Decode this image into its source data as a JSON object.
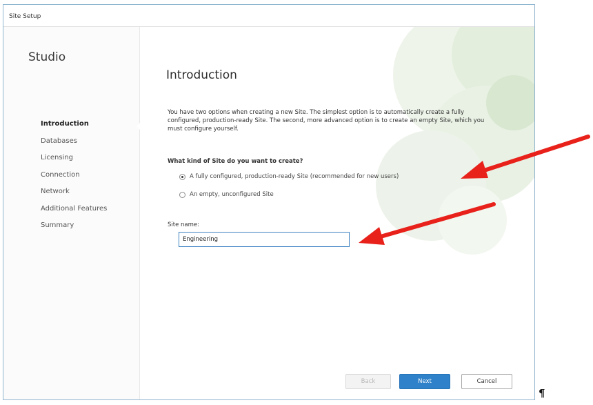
{
  "window": {
    "title": "Site Setup"
  },
  "sidebar": {
    "title": "Studio",
    "steps": [
      {
        "label": "Introduction",
        "active": true
      },
      {
        "label": "Databases"
      },
      {
        "label": "Licensing"
      },
      {
        "label": "Connection"
      },
      {
        "label": "Network"
      },
      {
        "label": "Additional Features"
      },
      {
        "label": "Summary"
      }
    ]
  },
  "main": {
    "title": "Introduction",
    "intro_text": "You have two options when creating a new Site. The simplest option is to automatically create a fully configured, production-ready Site. The second, more advanced option is to create an empty Site, which you must configure yourself.",
    "question": "What kind of Site do you want to create?",
    "options": [
      {
        "label": "A fully configured, production-ready Site (recommended for new users)",
        "selected": true
      },
      {
        "label": "An empty, unconfigured Site",
        "selected": false
      }
    ],
    "site_name_label": "Site name:",
    "site_name_value": "Engineering"
  },
  "buttons": {
    "back": "Back",
    "next": "Next",
    "cancel": "Cancel"
  },
  "document": {
    "pilcrow": "¶"
  },
  "colors": {
    "accent": "#2f81c9",
    "annotation_arrow": "#e8211b",
    "decor_green": "#c9dcc0"
  }
}
